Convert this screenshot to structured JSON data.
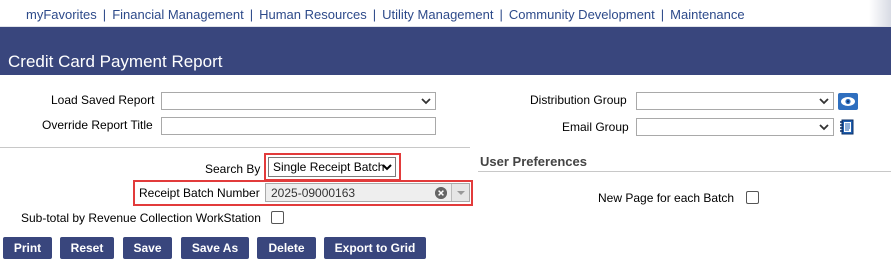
{
  "nav": {
    "items": [
      "myFavorites",
      "Financial Management",
      "Human Resources",
      "Utility Management",
      "Community Development",
      "Maintenance"
    ]
  },
  "page": {
    "title": "Credit Card Payment Report"
  },
  "form": {
    "load_saved_report_label": "Load Saved Report",
    "load_saved_report_value": "",
    "override_title_label": "Override Report Title",
    "override_title_value": "",
    "distribution_group_label": "Distribution Group",
    "distribution_group_value": "",
    "email_group_label": "Email Group",
    "email_group_value": "",
    "search_by_label": "Search By",
    "search_by_value": "Single Receipt Batch",
    "receipt_batch_label": "Receipt Batch Number",
    "receipt_batch_value": "2025-09000163",
    "subtotal_label": "Sub-total by Revenue Collection WorkStation",
    "subtotal_checked": false
  },
  "preferences": {
    "heading": "User Preferences",
    "new_page_label": "New Page for each Batch",
    "new_page_checked": false
  },
  "buttons": {
    "print": "Print",
    "reset": "Reset",
    "save": "Save",
    "save_as": "Save As",
    "delete": "Delete",
    "export": "Export to Grid"
  },
  "colors": {
    "brand": "#39467d",
    "nav_link": "#2d4a8a",
    "highlight": "#e23b3b"
  }
}
